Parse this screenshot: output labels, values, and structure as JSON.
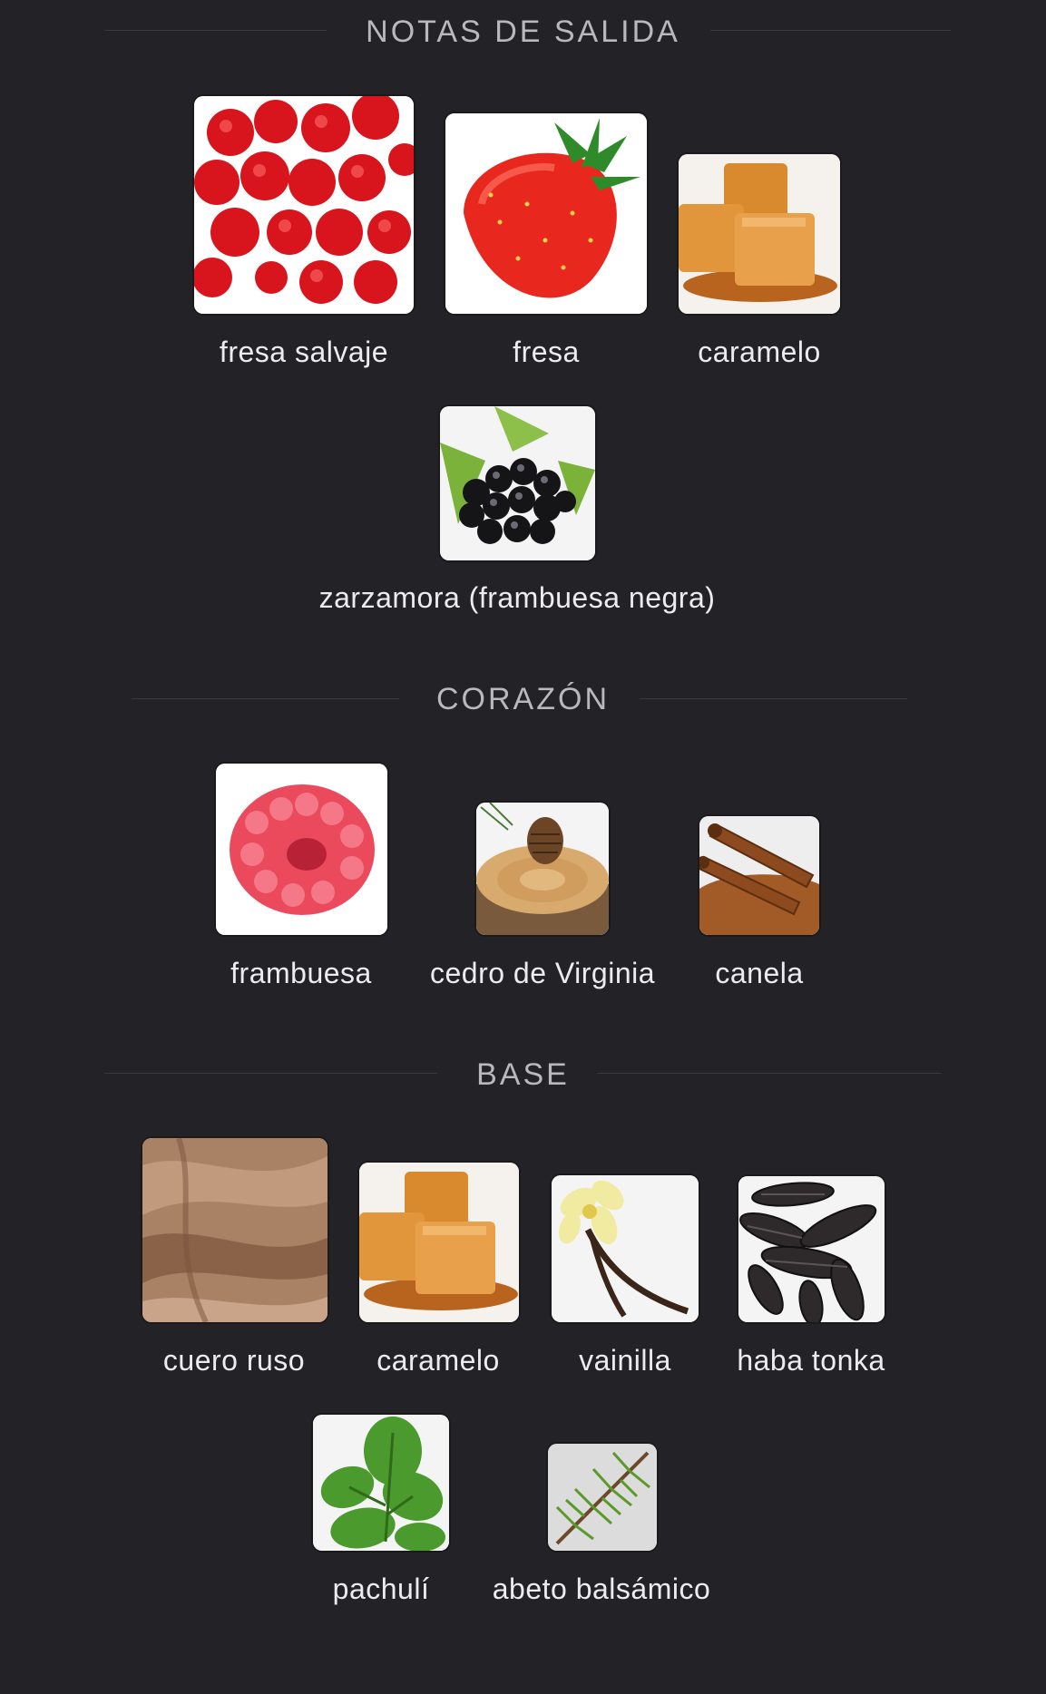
{
  "sections": {
    "top": {
      "title": "NOTAS DE SALIDA",
      "notes": [
        {
          "label": "fresa salvaje",
          "icon": "wild-strawberry-icon"
        },
        {
          "label": "fresa",
          "icon": "strawberry-icon"
        },
        {
          "label": "caramelo",
          "icon": "caramel-icon"
        },
        {
          "label": "zarzamora (frambuesa negra)",
          "icon": "blackberry-icon"
        }
      ]
    },
    "heart": {
      "title": "CORAZÓN",
      "notes": [
        {
          "label": "frambuesa",
          "icon": "raspberry-icon"
        },
        {
          "label": "cedro de Virginia",
          "icon": "cedar-icon"
        },
        {
          "label": "canela",
          "icon": "cinnamon-icon"
        }
      ]
    },
    "base": {
      "title": "BASE",
      "notes": [
        {
          "label": "cuero ruso",
          "icon": "leather-icon"
        },
        {
          "label": "caramelo",
          "icon": "caramel-icon"
        },
        {
          "label": "vainilla",
          "icon": "vanilla-icon"
        },
        {
          "label": "haba tonka",
          "icon": "tonka-bean-icon"
        },
        {
          "label": "pachulí",
          "icon": "patchouli-icon"
        },
        {
          "label": "abeto balsámico",
          "icon": "balsam-fir-icon"
        }
      ]
    }
  },
  "colors": {
    "background": "#232226",
    "title": "#b8b8bd",
    "label": "#ececef",
    "divider": "#3a393e"
  }
}
